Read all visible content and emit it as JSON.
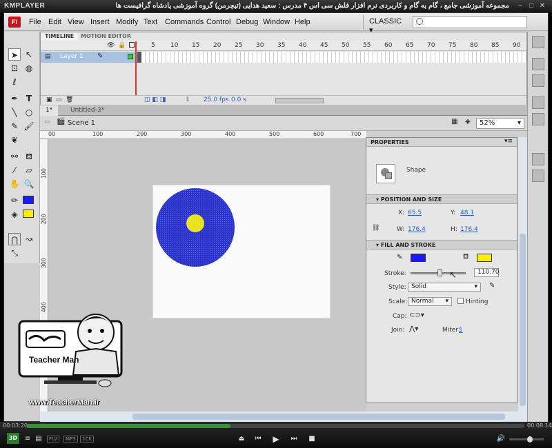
{
  "player": {
    "logo": "KMPLAYER",
    "video_title": "مجموعه آموزشی جامع ، گام به گام و کاربردی نرم افزار فلش سی اس ۴ مدرس : سعید هدایی (تیچرمن) گروه آموزشی پادشاه گرافیست ها",
    "time_elapsed": "00:03:20",
    "time_total": "00:08:14",
    "progress": 0.41,
    "badges": [
      "FLV",
      "MP3",
      "1CK"
    ]
  },
  "app": {
    "logo": "Fl",
    "menu": [
      "File",
      "Edit",
      "View",
      "Insert",
      "Modify",
      "Text",
      "Commands",
      "Control",
      "Debug",
      "Window",
      "Help"
    ],
    "workspace": "CLASSIC",
    "search_placeholder": ""
  },
  "timeline": {
    "tabs": [
      "TIMELINE",
      "MOTION EDITOR"
    ],
    "frame_numbers": [
      "5",
      "10",
      "15",
      "20",
      "25",
      "30",
      "35",
      "40",
      "45",
      "50",
      "55",
      "60",
      "65",
      "70",
      "75",
      "80",
      "85",
      "90"
    ],
    "layer_name": "Layer 1",
    "current_frame": "1",
    "fps": "25.0 fps",
    "time": "0.0 s"
  },
  "doc_tabs": [
    "1*",
    "Untitled-3*"
  ],
  "edit_bar": {
    "scene": "Scene 1",
    "zoom": "52%"
  },
  "rulers": {
    "top": [
      "00",
      "100",
      "200",
      "300",
      "400",
      "500",
      "600",
      "700"
    ],
    "left": [
      "100",
      "200",
      "300",
      "400"
    ]
  },
  "stage": {
    "outer_color": "#2b34cc",
    "inner_color": "#e8e21b"
  },
  "properties": {
    "title": "PROPERTIES",
    "object_type": "Shape",
    "position_header": "POSITION AND SIZE",
    "x_label": "X:",
    "x": "65.5",
    "y_label": "Y:",
    "y": "48.1",
    "w_label": "W:",
    "w": "176.4",
    "h_label": "H:",
    "h": "176.4",
    "fill_header": "FILL AND STROKE",
    "stroke_color": "#1a1aff",
    "fill_color": "#ffee00",
    "stroke_label": "Stroke:",
    "stroke_value": "110.70",
    "style_label": "Style:",
    "style_value": "Solid",
    "scale_label": "Scale:",
    "scale_value": "Normal",
    "hinting_label": "Hinting",
    "cap_label": "Cap:",
    "join_label": "Join:",
    "miter_label": "Miter:",
    "miter_value": "1"
  },
  "overlay": {
    "url": "www.TeacherMan.ir",
    "logo_text": "Teacher Man"
  }
}
